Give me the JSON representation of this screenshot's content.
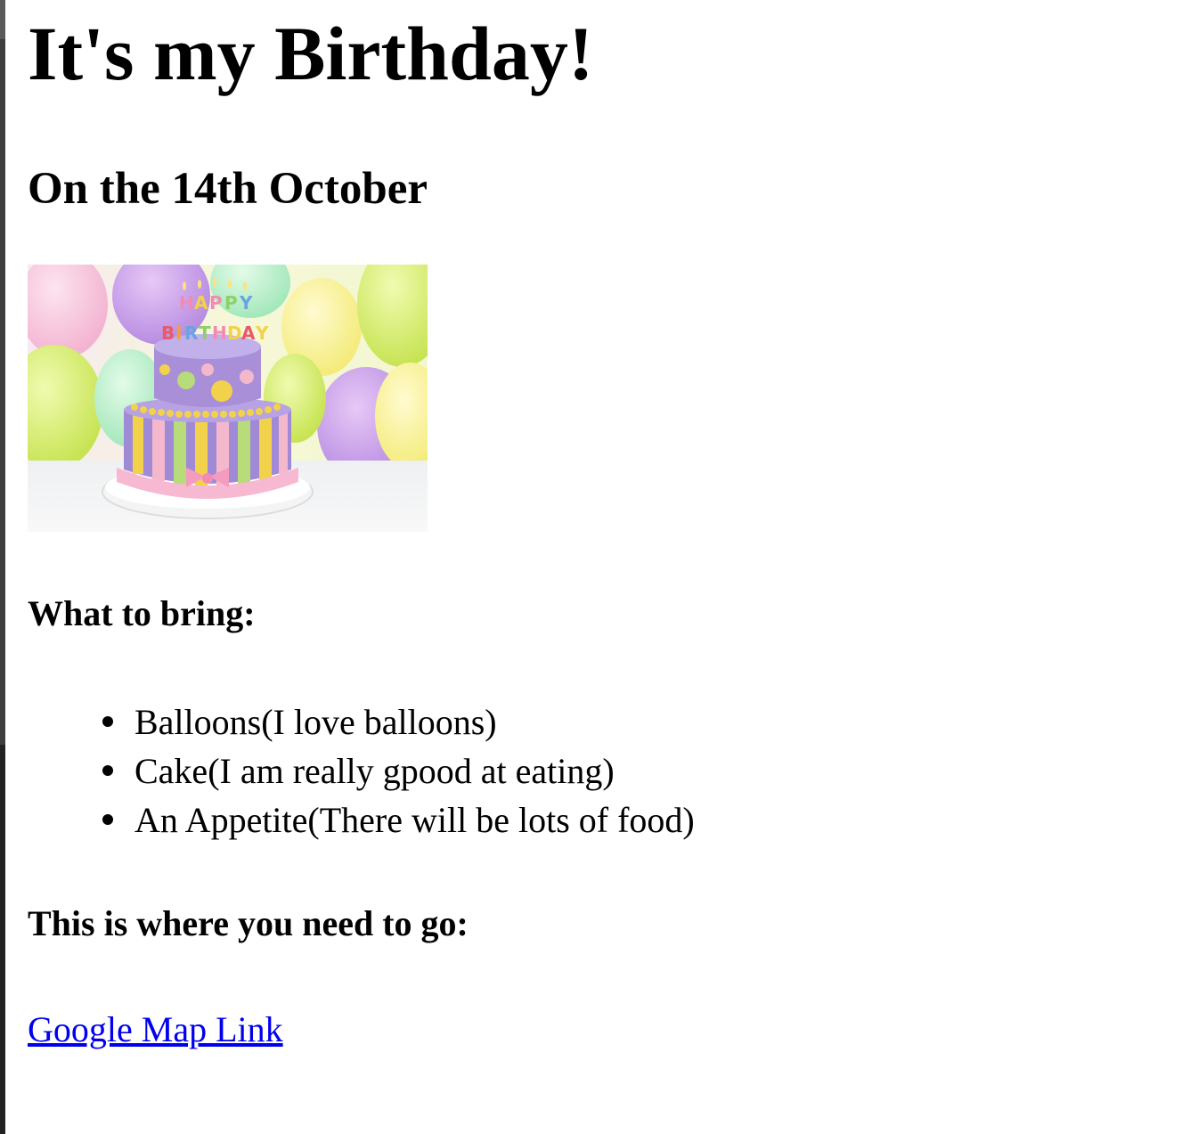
{
  "page": {
    "title": "It's my Birthday!",
    "date_heading": "On the 14th October",
    "bring_heading": "What to bring:",
    "bring_items": [
      "Balloons(I love balloons)",
      "Cake(I am really gpood at eating)",
      "An Appetite(There will be lots of food)"
    ],
    "where_heading": "This is where you need to go:",
    "map_link_text": "Google Map Link",
    "image_alt": "HAPPY BIRTHDAY"
  },
  "colors": {
    "text": "#000000",
    "link": "#0000ee",
    "background": "#ffffff",
    "cake_purple": "#a890d8",
    "cake_pink": "#f4b8cc",
    "cake_yellow": "#f2d24a",
    "cake_green": "#b8dc7a"
  }
}
